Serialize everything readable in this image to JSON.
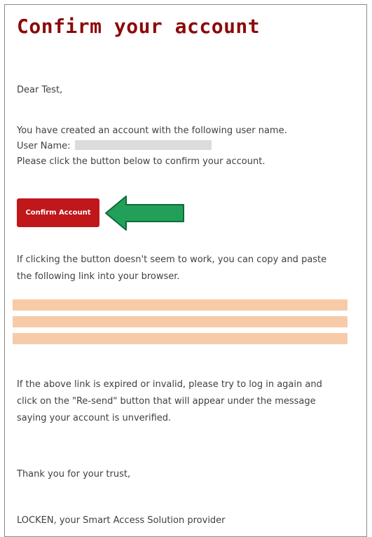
{
  "email": {
    "title": "Confirm your account",
    "greeting": "Dear Test,",
    "intro": "You have created an account with the following user name.",
    "username_label": "User Name:",
    "click_instruction": "Please click the button below to confirm your account.",
    "confirm_button_label": "Confirm Account",
    "fallback_line1": "If clicking the button doesn't seem to work, you can copy and paste",
    "fallback_line2": "the following link into your browser.",
    "expired_line1": "If the above link is expired or invalid, please try to log in again and",
    "expired_line2": "click on the \"Re-send\" button that will appear under the message",
    "expired_line3": "saying your account is unverified.",
    "thanks": "Thank you for your trust,",
    "signature": "LOCKEN, your Smart Access Solution provider"
  },
  "colors": {
    "title": "#8b0a0a",
    "button_bg": "#c0171a",
    "arrow_fill": "#22a05a",
    "arrow_stroke": "#0f6a3a",
    "redaction_gray": "#dcdcdc",
    "redaction_orange": "#f7cba8"
  },
  "icons": {
    "arrow": "left-arrow-icon"
  }
}
